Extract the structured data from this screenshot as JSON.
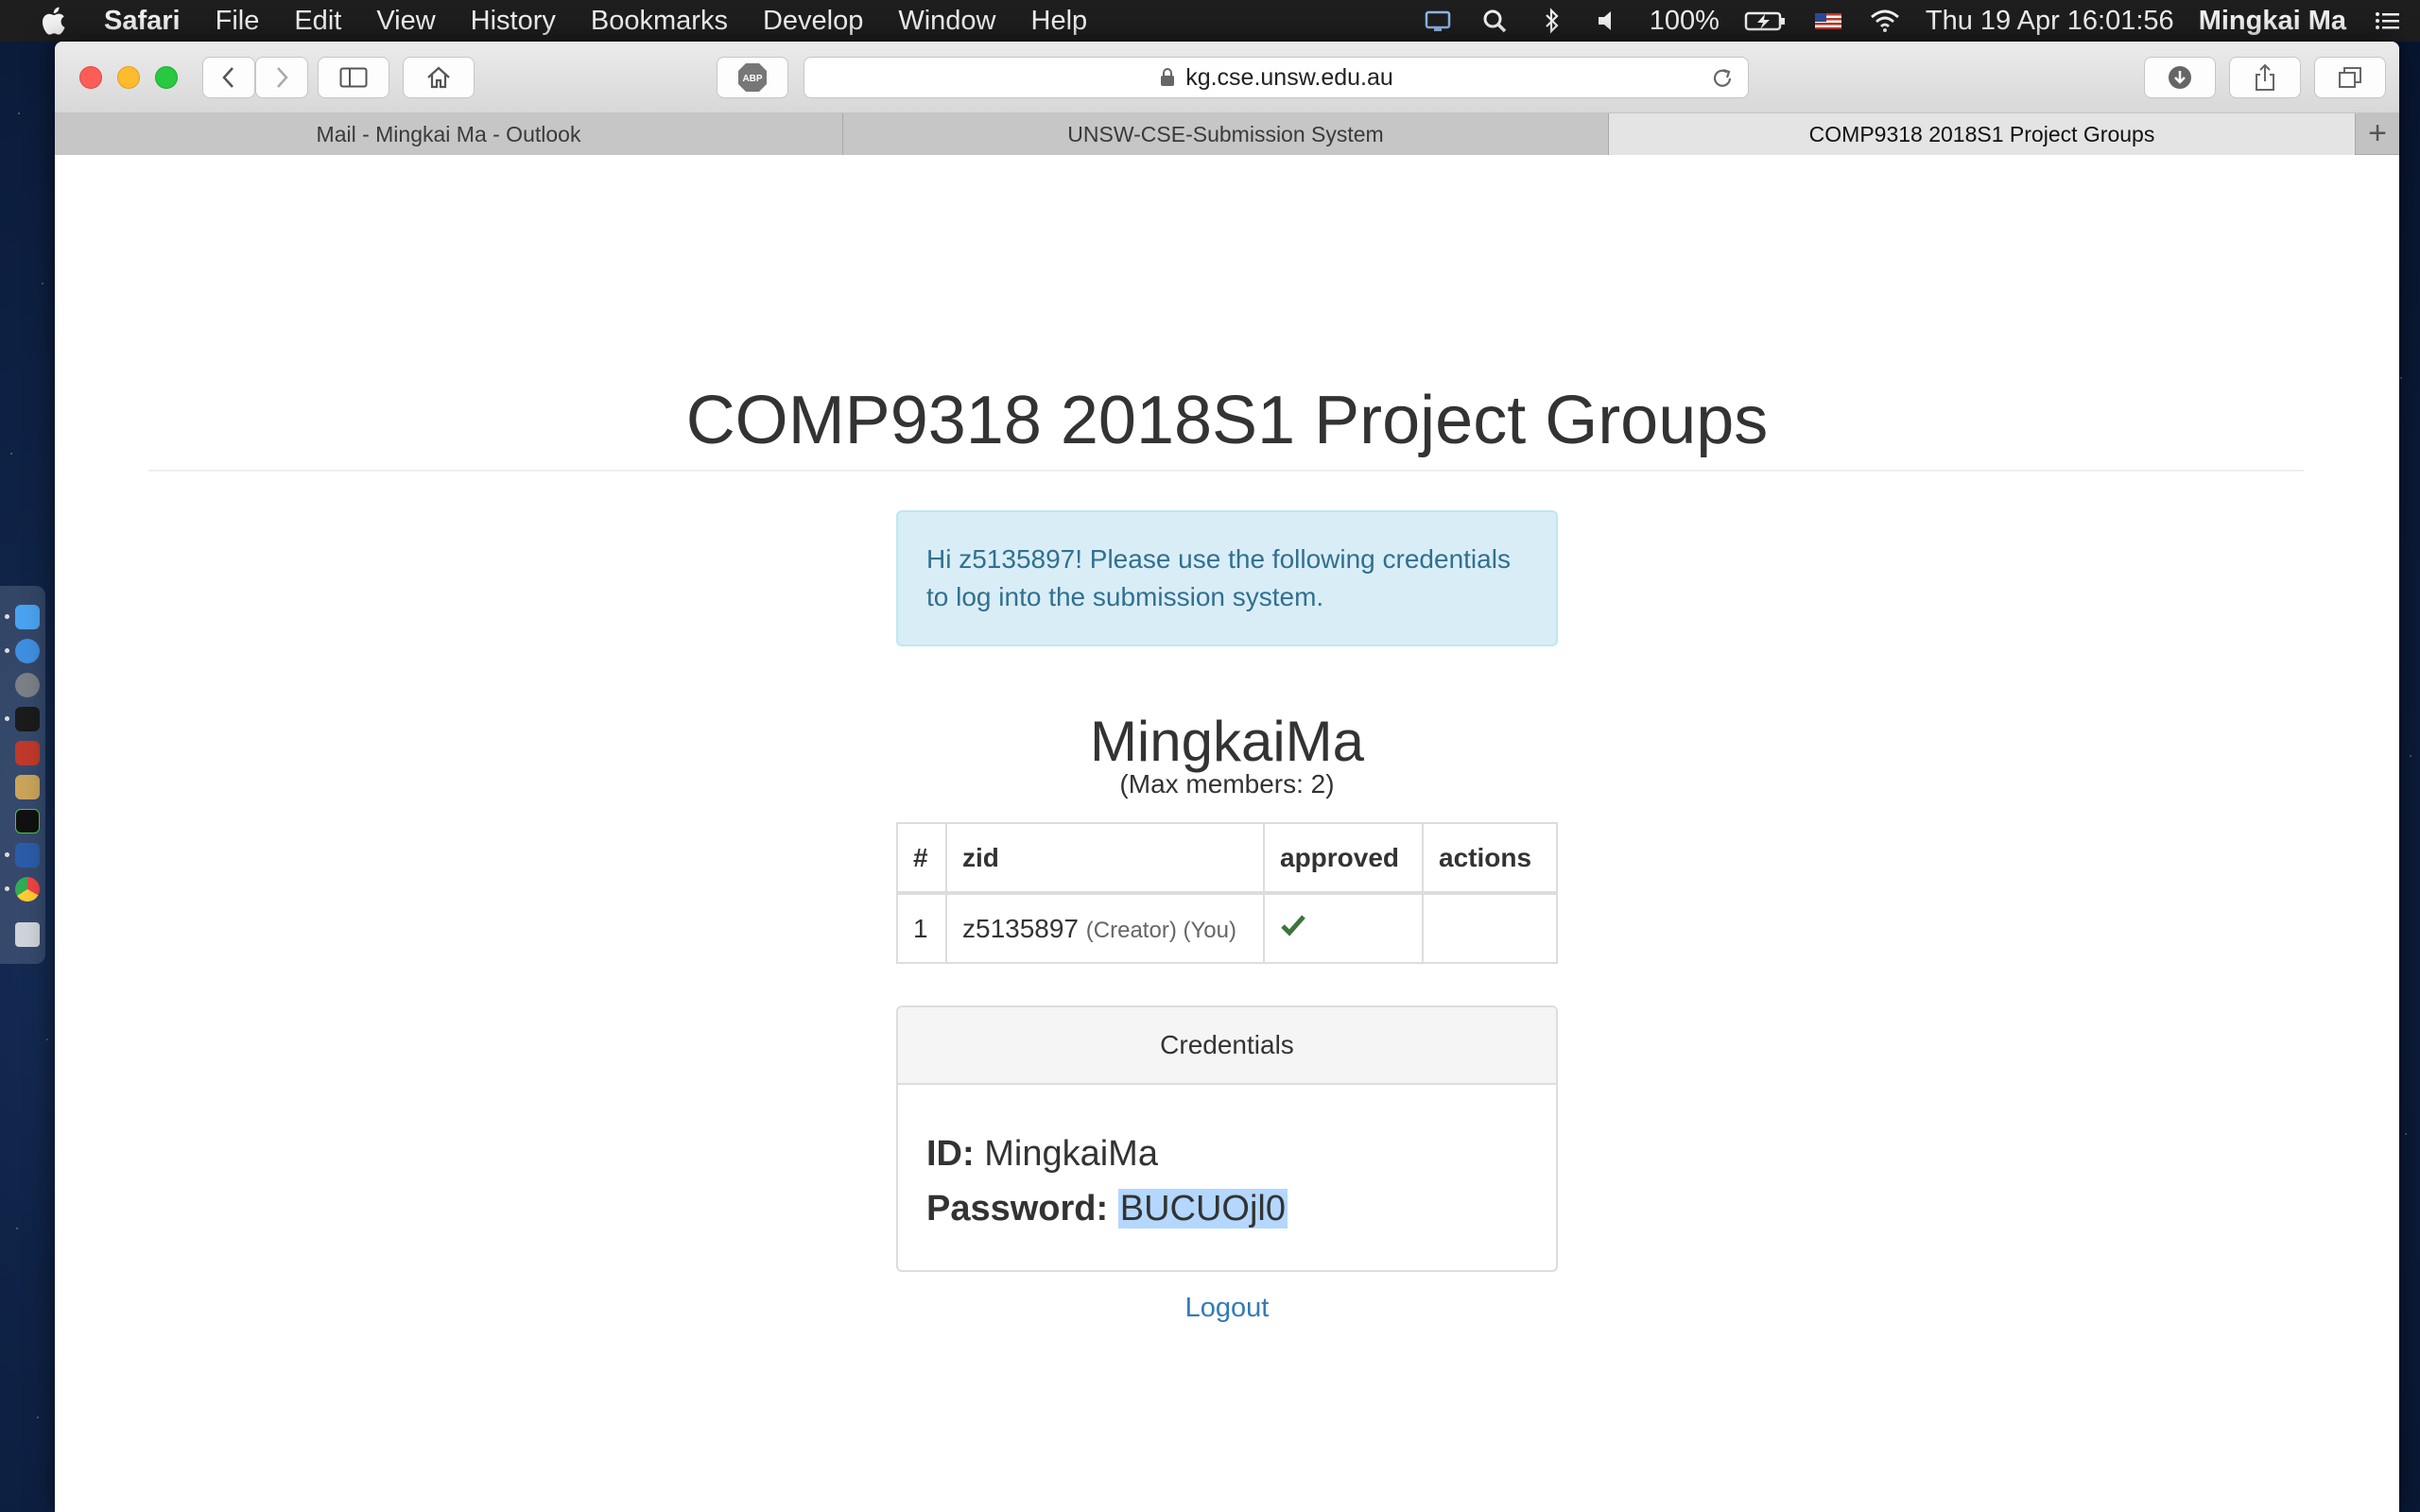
{
  "menubar": {
    "app_name": "Safari",
    "menus": [
      "File",
      "Edit",
      "View",
      "History",
      "Bookmarks",
      "Develop",
      "Window",
      "Help"
    ],
    "battery": "100%",
    "datetime": "Thu 19 Apr  16:01:56",
    "user": "Mingkai Ma"
  },
  "browser": {
    "url": "kg.cse.unsw.edu.au",
    "adblock_label": "ABP",
    "tabs": [
      {
        "title": "Mail - Mingkai Ma - Outlook",
        "active": false
      },
      {
        "title": "UNSW-CSE-Submission System",
        "active": false
      },
      {
        "title": "COMP9318 2018S1 Project Groups",
        "active": true
      }
    ],
    "new_tab_label": "+"
  },
  "page": {
    "title": "COMP9318 2018S1 Project Groups",
    "alert": "Hi z5135897! Please use the following credentials to log into the submission system.",
    "group_name": "MingkaiMa",
    "max_members": "(Max members: 2)",
    "table": {
      "headers": [
        "#",
        "zid",
        "approved",
        "actions"
      ],
      "rows": [
        {
          "num": "1",
          "zid": "z5135897",
          "tags": "(Creator) (You)",
          "approved": true,
          "actions": ""
        }
      ]
    },
    "credentials": {
      "heading": "Credentials",
      "id_label": "ID:",
      "id_value": "MingkaiMa",
      "password_label": "Password:",
      "password_value": "BUCUOjl0"
    },
    "logout": "Logout"
  },
  "colors": {
    "alert_bg": "#d9edf7",
    "alert_text": "#31708f",
    "link": "#337ab7",
    "check": "#3c763d",
    "selection": "#b3d7fe"
  }
}
